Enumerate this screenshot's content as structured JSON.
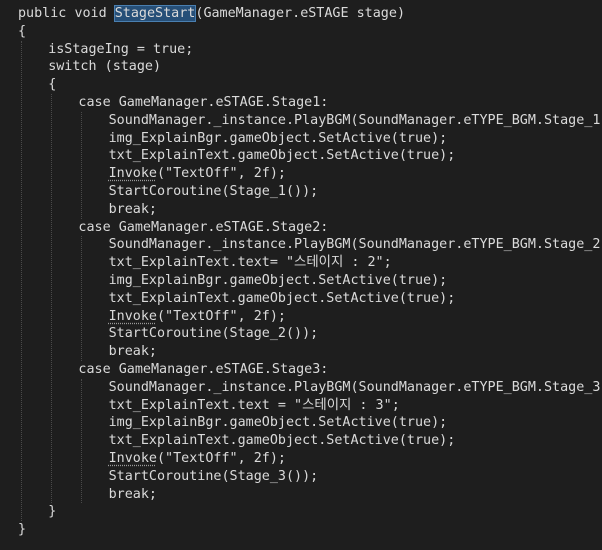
{
  "editor": {
    "top_fragment": "...",
    "colors": {
      "background": "#1e1e1e",
      "keyword": "#569cd6",
      "control_keyword": "#d8a0df",
      "type": "#4ec9b0",
      "method": "#dcdcaa",
      "string": "#d69d85",
      "number": "#b5cea8",
      "identifier": "#dadada",
      "highlight": "#264f78"
    },
    "lines": [
      {
        "indent": 0,
        "tokens": [
          {
            "k": "kw",
            "t": "public"
          },
          {
            "k": "pn",
            "t": " "
          },
          {
            "k": "kw",
            "t": "void"
          },
          {
            "k": "pn",
            "t": " "
          },
          {
            "k": "fn",
            "t": "StageStart",
            "hl": true
          },
          {
            "k": "pn",
            "t": "("
          },
          {
            "k": "typ",
            "t": "GameManager"
          },
          {
            "k": "pn",
            "t": "."
          },
          {
            "k": "typ",
            "t": "eSTAGE"
          },
          {
            "k": "pn",
            "t": " "
          },
          {
            "k": "id",
            "t": "stage"
          },
          {
            "k": "pn",
            "t": ")"
          }
        ]
      },
      {
        "indent": 0,
        "tokens": [
          {
            "k": "pn",
            "t": "{"
          }
        ]
      },
      {
        "indent": 1,
        "tokens": [
          {
            "k": "id",
            "t": "isStageIng"
          },
          {
            "k": "pn",
            "t": " = "
          },
          {
            "k": "kw",
            "t": "true"
          },
          {
            "k": "pn",
            "t": ";"
          }
        ]
      },
      {
        "indent": 1,
        "tokens": [
          {
            "k": "ctl",
            "t": "switch"
          },
          {
            "k": "pn",
            "t": " ("
          },
          {
            "k": "id",
            "t": "stage"
          },
          {
            "k": "pn",
            "t": ")"
          }
        ]
      },
      {
        "indent": 1,
        "tokens": [
          {
            "k": "pn",
            "t": "{"
          }
        ]
      },
      {
        "indent": 2,
        "tokens": [
          {
            "k": "ctl",
            "t": "case"
          },
          {
            "k": "pn",
            "t": " "
          },
          {
            "k": "typ",
            "t": "GameManager"
          },
          {
            "k": "pn",
            "t": "."
          },
          {
            "k": "typ",
            "t": "eSTAGE"
          },
          {
            "k": "pn",
            "t": "."
          },
          {
            "k": "id",
            "t": "Stage1"
          },
          {
            "k": "pn",
            "t": ":"
          }
        ]
      },
      {
        "indent": 3,
        "tokens": [
          {
            "k": "typ",
            "t": "SoundManager"
          },
          {
            "k": "pn",
            "t": "."
          },
          {
            "k": "id",
            "t": "_instance"
          },
          {
            "k": "pn",
            "t": "."
          },
          {
            "k": "fn",
            "t": "PlayBGM"
          },
          {
            "k": "pn",
            "t": "("
          },
          {
            "k": "typ",
            "t": "SoundManager"
          },
          {
            "k": "pn",
            "t": "."
          },
          {
            "k": "typ",
            "t": "eTYPE_BGM"
          },
          {
            "k": "pn",
            "t": "."
          },
          {
            "k": "id",
            "t": "Stage_1"
          },
          {
            "k": "pn",
            "t": ");"
          }
        ]
      },
      {
        "indent": 3,
        "tokens": [
          {
            "k": "id",
            "t": "img_ExplainBgr"
          },
          {
            "k": "pn",
            "t": "."
          },
          {
            "k": "id",
            "t": "gameObject"
          },
          {
            "k": "pn",
            "t": "."
          },
          {
            "k": "fn",
            "t": "SetActive"
          },
          {
            "k": "pn",
            "t": "("
          },
          {
            "k": "kw",
            "t": "true"
          },
          {
            "k": "pn",
            "t": ");"
          }
        ]
      },
      {
        "indent": 3,
        "tokens": [
          {
            "k": "id",
            "t": "txt_ExplainText"
          },
          {
            "k": "pn",
            "t": "."
          },
          {
            "k": "id",
            "t": "gameObject"
          },
          {
            "k": "pn",
            "t": "."
          },
          {
            "k": "fn",
            "t": "SetActive"
          },
          {
            "k": "pn",
            "t": "("
          },
          {
            "k": "kw",
            "t": "true"
          },
          {
            "k": "pn",
            "t": ");"
          }
        ]
      },
      {
        "indent": 3,
        "tokens": [
          {
            "k": "fn",
            "t": "Invoke",
            "sq": true
          },
          {
            "k": "pn",
            "t": "("
          },
          {
            "k": "str",
            "t": "\"TextOff\""
          },
          {
            "k": "pn",
            "t": ", "
          },
          {
            "k": "num",
            "t": "2f"
          },
          {
            "k": "pn",
            "t": ");"
          }
        ]
      },
      {
        "indent": 3,
        "tokens": [
          {
            "k": "fn",
            "t": "StartCoroutine"
          },
          {
            "k": "pn",
            "t": "("
          },
          {
            "k": "fn",
            "t": "Stage_1"
          },
          {
            "k": "pn",
            "t": "());"
          }
        ]
      },
      {
        "indent": 3,
        "tokens": [
          {
            "k": "ctl",
            "t": "break"
          },
          {
            "k": "pn",
            "t": ";"
          }
        ]
      },
      {
        "indent": 2,
        "tokens": [
          {
            "k": "ctl",
            "t": "case"
          },
          {
            "k": "pn",
            "t": " "
          },
          {
            "k": "typ",
            "t": "GameManager"
          },
          {
            "k": "pn",
            "t": "."
          },
          {
            "k": "typ",
            "t": "eSTAGE"
          },
          {
            "k": "pn",
            "t": "."
          },
          {
            "k": "id",
            "t": "Stage2"
          },
          {
            "k": "pn",
            "t": ":"
          }
        ]
      },
      {
        "indent": 3,
        "tokens": [
          {
            "k": "typ",
            "t": "SoundManager"
          },
          {
            "k": "pn",
            "t": "."
          },
          {
            "k": "id",
            "t": "_instance"
          },
          {
            "k": "pn",
            "t": "."
          },
          {
            "k": "fn",
            "t": "PlayBGM"
          },
          {
            "k": "pn",
            "t": "("
          },
          {
            "k": "typ",
            "t": "SoundManager"
          },
          {
            "k": "pn",
            "t": "."
          },
          {
            "k": "typ",
            "t": "eTYPE_BGM"
          },
          {
            "k": "pn",
            "t": "."
          },
          {
            "k": "id",
            "t": "Stage_2"
          },
          {
            "k": "pn",
            "t": ");"
          }
        ]
      },
      {
        "indent": 3,
        "tokens": [
          {
            "k": "id",
            "t": "txt_ExplainText"
          },
          {
            "k": "pn",
            "t": "."
          },
          {
            "k": "id",
            "t": "text"
          },
          {
            "k": "pn",
            "t": "= "
          },
          {
            "k": "str",
            "t": "\"스테이지 : 2\""
          },
          {
            "k": "pn",
            "t": ";"
          }
        ]
      },
      {
        "indent": 3,
        "tokens": [
          {
            "k": "id",
            "t": "img_ExplainBgr"
          },
          {
            "k": "pn",
            "t": "."
          },
          {
            "k": "id",
            "t": "gameObject"
          },
          {
            "k": "pn",
            "t": "."
          },
          {
            "k": "fn",
            "t": "SetActive"
          },
          {
            "k": "pn",
            "t": "("
          },
          {
            "k": "kw",
            "t": "true"
          },
          {
            "k": "pn",
            "t": ");"
          }
        ]
      },
      {
        "indent": 3,
        "tokens": [
          {
            "k": "id",
            "t": "txt_ExplainText"
          },
          {
            "k": "pn",
            "t": "."
          },
          {
            "k": "id",
            "t": "gameObject"
          },
          {
            "k": "pn",
            "t": "."
          },
          {
            "k": "fn",
            "t": "SetActive"
          },
          {
            "k": "pn",
            "t": "("
          },
          {
            "k": "kw",
            "t": "true"
          },
          {
            "k": "pn",
            "t": ");"
          }
        ]
      },
      {
        "indent": 3,
        "tokens": [
          {
            "k": "fn",
            "t": "Invoke",
            "sq": true
          },
          {
            "k": "pn",
            "t": "("
          },
          {
            "k": "str",
            "t": "\"TextOff\""
          },
          {
            "k": "pn",
            "t": ", "
          },
          {
            "k": "num",
            "t": "2f"
          },
          {
            "k": "pn",
            "t": ");"
          }
        ]
      },
      {
        "indent": 3,
        "tokens": [
          {
            "k": "fn",
            "t": "StartCoroutine"
          },
          {
            "k": "pn",
            "t": "("
          },
          {
            "k": "fn",
            "t": "Stage_2"
          },
          {
            "k": "pn",
            "t": "());"
          }
        ]
      },
      {
        "indent": 3,
        "tokens": [
          {
            "k": "ctl",
            "t": "break"
          },
          {
            "k": "pn",
            "t": ";"
          }
        ]
      },
      {
        "indent": 2,
        "tokens": [
          {
            "k": "ctl",
            "t": "case"
          },
          {
            "k": "pn",
            "t": " "
          },
          {
            "k": "typ",
            "t": "GameManager"
          },
          {
            "k": "pn",
            "t": "."
          },
          {
            "k": "typ",
            "t": "eSTAGE"
          },
          {
            "k": "pn",
            "t": "."
          },
          {
            "k": "id",
            "t": "Stage3"
          },
          {
            "k": "pn",
            "t": ":"
          }
        ]
      },
      {
        "indent": 3,
        "tokens": [
          {
            "k": "typ",
            "t": "SoundManager"
          },
          {
            "k": "pn",
            "t": "."
          },
          {
            "k": "id",
            "t": "_instance"
          },
          {
            "k": "pn",
            "t": "."
          },
          {
            "k": "fn",
            "t": "PlayBGM"
          },
          {
            "k": "pn",
            "t": "("
          },
          {
            "k": "typ",
            "t": "SoundManager"
          },
          {
            "k": "pn",
            "t": "."
          },
          {
            "k": "typ",
            "t": "eTYPE_BGM"
          },
          {
            "k": "pn",
            "t": "."
          },
          {
            "k": "id",
            "t": "Stage_3"
          },
          {
            "k": "pn",
            "t": ");"
          }
        ]
      },
      {
        "indent": 3,
        "tokens": [
          {
            "k": "id",
            "t": "txt_ExplainText"
          },
          {
            "k": "pn",
            "t": "."
          },
          {
            "k": "id",
            "t": "text"
          },
          {
            "k": "pn",
            "t": " = "
          },
          {
            "k": "str",
            "t": "\"스테이지 : 3\""
          },
          {
            "k": "pn",
            "t": ";"
          }
        ]
      },
      {
        "indent": 3,
        "tokens": [
          {
            "k": "id",
            "t": "img_ExplainBgr"
          },
          {
            "k": "pn",
            "t": "."
          },
          {
            "k": "id",
            "t": "gameObject"
          },
          {
            "k": "pn",
            "t": "."
          },
          {
            "k": "fn",
            "t": "SetActive"
          },
          {
            "k": "pn",
            "t": "("
          },
          {
            "k": "kw",
            "t": "true"
          },
          {
            "k": "pn",
            "t": ");"
          }
        ]
      },
      {
        "indent": 3,
        "tokens": [
          {
            "k": "id",
            "t": "txt_ExplainText"
          },
          {
            "k": "pn",
            "t": "."
          },
          {
            "k": "id",
            "t": "gameObject"
          },
          {
            "k": "pn",
            "t": "."
          },
          {
            "k": "fn",
            "t": "SetActive"
          },
          {
            "k": "pn",
            "t": "("
          },
          {
            "k": "kw",
            "t": "true"
          },
          {
            "k": "pn",
            "t": ");"
          }
        ]
      },
      {
        "indent": 3,
        "tokens": [
          {
            "k": "fn",
            "t": "Invoke",
            "sq": true
          },
          {
            "k": "pn",
            "t": "("
          },
          {
            "k": "str",
            "t": "\"TextOff\""
          },
          {
            "k": "pn",
            "t": ", "
          },
          {
            "k": "num",
            "t": "2f"
          },
          {
            "k": "pn",
            "t": ");"
          }
        ]
      },
      {
        "indent": 3,
        "tokens": [
          {
            "k": "fn",
            "t": "StartCoroutine"
          },
          {
            "k": "pn",
            "t": "("
          },
          {
            "k": "fn",
            "t": "Stage_3"
          },
          {
            "k": "pn",
            "t": "());"
          }
        ]
      },
      {
        "indent": 3,
        "tokens": [
          {
            "k": "ctl",
            "t": "break"
          },
          {
            "k": "pn",
            "t": ";"
          }
        ]
      },
      {
        "indent": 1,
        "tokens": [
          {
            "k": "pn",
            "t": "}"
          }
        ]
      },
      {
        "indent": 0,
        "tokens": [
          {
            "k": "pn",
            "t": "}"
          }
        ]
      }
    ]
  }
}
